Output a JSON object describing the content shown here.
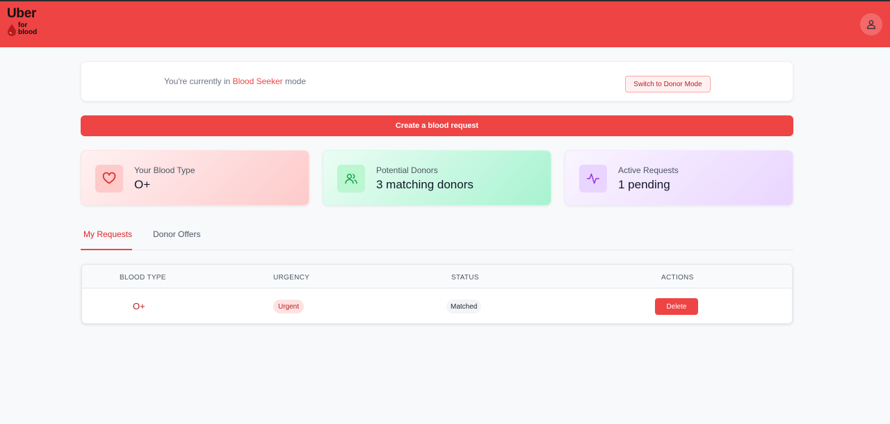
{
  "brand": {
    "word1": "Uber",
    "word2": "for",
    "word3": "blood",
    "color": "#ef4444"
  },
  "header": {
    "avatar_icon": "user-icon"
  },
  "mode": {
    "prefix": "You're currently in",
    "mode_name": "Blood Seeker",
    "suffix": "mode",
    "switch_label": "Switch to Donor Mode"
  },
  "create_button": {
    "label": "Create a blood request"
  },
  "stats": [
    {
      "icon": "heart-icon",
      "label": "Your Blood Type",
      "value": "O+"
    },
    {
      "icon": "users-icon",
      "label": "Potential Donors",
      "value": "3 matching donors"
    },
    {
      "icon": "activity-icon",
      "label": "Active Requests",
      "value": "1 pending"
    }
  ],
  "tabs": [
    {
      "label": "My Requests",
      "active": true
    },
    {
      "label": "Donor Offers",
      "active": false
    }
  ],
  "table": {
    "columns": [
      "BLOOD TYPE",
      "URGENCY",
      "STATUS",
      "ACTIONS"
    ],
    "rows": [
      {
        "blood_type": "O+",
        "urgency": "Urgent",
        "status": "Matched",
        "action": "Delete"
      }
    ]
  }
}
